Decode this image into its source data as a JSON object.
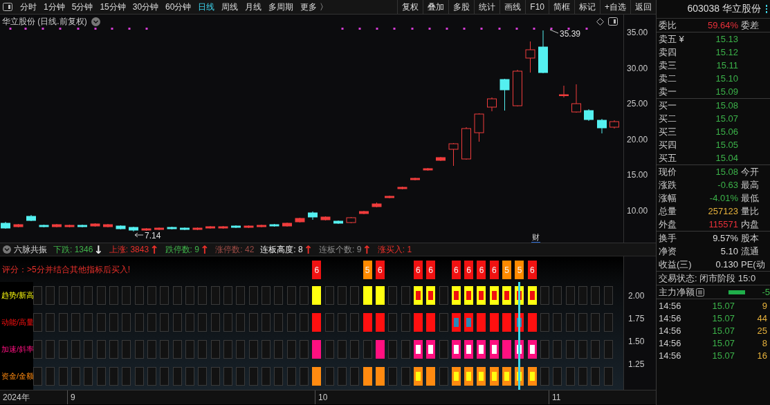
{
  "toolbar": {
    "periods": [
      {
        "label": "分时",
        "selected": false
      },
      {
        "label": "1分钟",
        "selected": false
      },
      {
        "label": "5分钟",
        "selected": false
      },
      {
        "label": "15分钟",
        "selected": false
      },
      {
        "label": "30分钟",
        "selected": false
      },
      {
        "label": "60分钟",
        "selected": false
      },
      {
        "label": "日线",
        "selected": true
      },
      {
        "label": "周线",
        "selected": false
      },
      {
        "label": "月线",
        "selected": false
      },
      {
        "label": "多周期",
        "selected": false
      },
      {
        "label": "更多 〉",
        "selected": false
      }
    ],
    "tools": [
      "复权",
      "叠加",
      "多股",
      "统计",
      "画线",
      "F10",
      "简框",
      "标记",
      "+自选",
      "返回"
    ]
  },
  "chart": {
    "title": "华立股份 (日线.前复权)",
    "price_axis": [
      "35.00",
      "30.00",
      "25.00",
      "20.00",
      "15.00",
      "10.00"
    ],
    "high_label": "35.39",
    "low_label": "7.14",
    "event_marker": "财"
  },
  "indicator": {
    "title": "六脉共振",
    "stats": [
      {
        "label": "下跌: 1346",
        "color": "#3fb24a",
        "arrow": {
          "text": "↓",
          "color": "#eeeeee"
        }
      },
      {
        "label": "上涨: 3843",
        "color": "#e8302a",
        "arrow": {
          "text": "↑",
          "color": "#e8302a"
        }
      },
      {
        "label": "跌停数: 9",
        "color": "#3fb24a",
        "arrow": {
          "text": "↑",
          "color": "#e8302a"
        }
      },
      {
        "label": "涨停数: 42",
        "color": "#9a4a44"
      },
      {
        "label": "连板高度: 8",
        "color": "#f0f0f0",
        "arrow": {
          "text": "↑",
          "color": "#e8302a"
        }
      },
      {
        "label": "连板个数: 9",
        "color": "#8c8c8c",
        "arrow": {
          "text": "↑",
          "color": "#e8302a"
        }
      },
      {
        "label": "涨买入: 1",
        "color": "#e8302a"
      }
    ],
    "hint": "评分：>5分并结合其他指标后买入!",
    "scores": [
      {
        "kind": "none",
        "cursor": false
      },
      {
        "kind": "none",
        "cursor": false
      },
      {
        "kind": "none",
        "cursor": false
      },
      {
        "kind": "none",
        "cursor": false
      },
      {
        "kind": "none",
        "cursor": false
      },
      {
        "kind": "none",
        "cursor": false
      },
      {
        "kind": "none",
        "cursor": false
      },
      {
        "kind": "none",
        "cursor": false
      },
      {
        "kind": "none",
        "cursor": false
      },
      {
        "kind": "none",
        "cursor": false
      },
      {
        "kind": "none",
        "cursor": false
      },
      {
        "kind": "none",
        "cursor": false
      },
      {
        "kind": "none",
        "cursor": false
      },
      {
        "kind": "none",
        "cursor": false
      },
      {
        "kind": "none",
        "cursor": false
      },
      {
        "kind": "none",
        "cursor": false
      },
      {
        "kind": "none",
        "cursor": false
      },
      {
        "kind": "none",
        "cursor": false
      },
      {
        "kind": "none",
        "cursor": false
      },
      {
        "kind": "none",
        "cursor": false
      },
      {
        "kind": "none",
        "cursor": false
      },
      {
        "kind": "none",
        "cursor": false
      },
      {
        "kind": "score",
        "text": "6",
        "color": "#f01212",
        "cursor": false
      },
      {
        "kind": "none",
        "cursor": false
      },
      {
        "kind": "none",
        "cursor": false
      },
      {
        "kind": "none",
        "cursor": false
      },
      {
        "kind": "score",
        "text": "5",
        "color": "#ff8a00",
        "cursor": false
      },
      {
        "kind": "score",
        "text": "6",
        "color": "#f01212",
        "cursor": false
      },
      {
        "kind": "none",
        "cursor": false
      },
      {
        "kind": "none",
        "cursor": false
      },
      {
        "kind": "score",
        "text": "6",
        "color": "#f01212",
        "cursor": false
      },
      {
        "kind": "score",
        "text": "6",
        "color": "#f01212",
        "cursor": false
      },
      {
        "kind": "none",
        "cursor": false
      },
      {
        "kind": "score",
        "text": "6",
        "color": "#f01212",
        "cursor": false
      },
      {
        "kind": "score",
        "text": "6",
        "color": "#f01212",
        "cursor": false
      },
      {
        "kind": "score",
        "text": "6",
        "color": "#f01212",
        "cursor": false
      },
      {
        "kind": "score",
        "text": "6",
        "color": "#f01212",
        "cursor": false
      },
      {
        "kind": "score",
        "text": "5",
        "color": "#ff8a00",
        "cursor": false
      },
      {
        "kind": "score",
        "text": "5",
        "color": "#ff8a00",
        "cursor": true
      },
      {
        "kind": "score",
        "text": "6",
        "color": "#f01212",
        "cursor": false
      },
      {
        "kind": "none",
        "cursor": false
      },
      {
        "kind": "none",
        "cursor": false
      },
      {
        "kind": "none",
        "cursor": false
      },
      {
        "kind": "none",
        "cursor": false
      },
      {
        "kind": "none",
        "cursor": false
      },
      {
        "kind": "none",
        "cursor": false
      }
    ],
    "rows": [
      {
        "kind": "trend",
        "label": "趋势/新高",
        "color": "#ffff10",
        "cells": [
          {
            "filled": false,
            "marked": false
          },
          {
            "filled": false,
            "marked": false
          },
          {
            "filled": false,
            "marked": false
          },
          {
            "filled": false,
            "marked": false
          },
          {
            "filled": false,
            "marked": false
          },
          {
            "filled": false,
            "marked": false
          },
          {
            "filled": false,
            "marked": false
          },
          {
            "filled": false,
            "marked": false
          },
          {
            "filled": false,
            "marked": false
          },
          {
            "filled": false,
            "marked": false
          },
          {
            "filled": false,
            "marked": false
          },
          {
            "filled": false,
            "marked": false
          },
          {
            "filled": false,
            "marked": false
          },
          {
            "filled": false,
            "marked": false
          },
          {
            "filled": false,
            "marked": false
          },
          {
            "filled": false,
            "marked": false
          },
          {
            "filled": false,
            "marked": false
          },
          {
            "filled": false,
            "marked": false
          },
          {
            "filled": false,
            "marked": false
          },
          {
            "filled": false,
            "marked": false
          },
          {
            "filled": false,
            "marked": false
          },
          {
            "filled": false,
            "marked": false
          },
          {
            "filled": true,
            "marked": false
          },
          {
            "filled": false,
            "marked": false
          },
          {
            "filled": false,
            "marked": false
          },
          {
            "filled": false,
            "marked": false
          },
          {
            "filled": true,
            "marked": false
          },
          {
            "filled": true,
            "marked": false
          },
          {
            "filled": false,
            "marked": false
          },
          {
            "filled": false,
            "marked": false
          },
          {
            "filled": true,
            "marked": true
          },
          {
            "filled": true,
            "marked": true
          },
          {
            "filled": false,
            "marked": false
          },
          {
            "filled": true,
            "marked": true
          },
          {
            "filled": true,
            "marked": true
          },
          {
            "filled": true,
            "marked": true
          },
          {
            "filled": true,
            "marked": true
          },
          {
            "filled": true,
            "marked": true
          },
          {
            "filled": true,
            "marked": true
          },
          {
            "filled": true,
            "marked": true
          },
          {
            "filled": false,
            "marked": false
          },
          {
            "filled": false,
            "marked": false
          },
          {
            "filled": false,
            "marked": false
          },
          {
            "filled": false,
            "marked": false
          },
          {
            "filled": false,
            "marked": false
          },
          {
            "filled": false,
            "marked": false
          }
        ]
      },
      {
        "kind": "momentum",
        "label": "动能/高量",
        "color": "#ff1010",
        "cells": [
          {
            "filled": false,
            "marked": false
          },
          {
            "filled": false,
            "marked": false
          },
          {
            "filled": false,
            "marked": false
          },
          {
            "filled": false,
            "marked": false
          },
          {
            "filled": false,
            "marked": false
          },
          {
            "filled": false,
            "marked": false
          },
          {
            "filled": false,
            "marked": false
          },
          {
            "filled": false,
            "marked": false
          },
          {
            "filled": false,
            "marked": false
          },
          {
            "filled": false,
            "marked": false
          },
          {
            "filled": false,
            "marked": false
          },
          {
            "filled": false,
            "marked": false
          },
          {
            "filled": false,
            "marked": false
          },
          {
            "filled": false,
            "marked": false
          },
          {
            "filled": false,
            "marked": false
          },
          {
            "filled": false,
            "marked": false
          },
          {
            "filled": false,
            "marked": false
          },
          {
            "filled": false,
            "marked": false
          },
          {
            "filled": false,
            "marked": false
          },
          {
            "filled": false,
            "marked": false
          },
          {
            "filled": false,
            "marked": false
          },
          {
            "filled": false,
            "marked": false
          },
          {
            "filled": true,
            "marked": false
          },
          {
            "filled": false,
            "marked": false
          },
          {
            "filled": false,
            "marked": false
          },
          {
            "filled": false,
            "marked": false
          },
          {
            "filled": true,
            "marked": false
          },
          {
            "filled": true,
            "marked": false
          },
          {
            "filled": false,
            "marked": false
          },
          {
            "filled": false,
            "marked": false
          },
          {
            "filled": true,
            "marked": false
          },
          {
            "filled": true,
            "marked": false
          },
          {
            "filled": false,
            "marked": false
          },
          {
            "filled": true,
            "marked": true
          },
          {
            "filled": true,
            "marked": true
          },
          {
            "filled": true,
            "marked": false
          },
          {
            "filled": true,
            "marked": false
          },
          {
            "filled": true,
            "marked": false
          },
          {
            "filled": true,
            "marked": true
          },
          {
            "filled": true,
            "marked": false
          },
          {
            "filled": false,
            "marked": false
          },
          {
            "filled": false,
            "marked": false
          },
          {
            "filled": false,
            "marked": false
          },
          {
            "filled": false,
            "marked": false
          },
          {
            "filled": false,
            "marked": false
          },
          {
            "filled": false,
            "marked": false
          }
        ]
      },
      {
        "kind": "acceleration",
        "label": "加速/斜率",
        "color": "#ff1080",
        "cells": [
          {
            "filled": false,
            "marked": false
          },
          {
            "filled": false,
            "marked": false
          },
          {
            "filled": false,
            "marked": false
          },
          {
            "filled": false,
            "marked": false
          },
          {
            "filled": false,
            "marked": false
          },
          {
            "filled": false,
            "marked": false
          },
          {
            "filled": false,
            "marked": false
          },
          {
            "filled": false,
            "marked": false
          },
          {
            "filled": false,
            "marked": false
          },
          {
            "filled": false,
            "marked": false
          },
          {
            "filled": false,
            "marked": false
          },
          {
            "filled": false,
            "marked": false
          },
          {
            "filled": false,
            "marked": false
          },
          {
            "filled": false,
            "marked": false
          },
          {
            "filled": false,
            "marked": false
          },
          {
            "filled": false,
            "marked": false
          },
          {
            "filled": false,
            "marked": false
          },
          {
            "filled": false,
            "marked": false
          },
          {
            "filled": false,
            "marked": false
          },
          {
            "filled": false,
            "marked": false
          },
          {
            "filled": false,
            "marked": false
          },
          {
            "filled": false,
            "marked": false
          },
          {
            "filled": true,
            "marked": false
          },
          {
            "filled": false,
            "marked": false
          },
          {
            "filled": false,
            "marked": false
          },
          {
            "filled": false,
            "marked": false
          },
          {
            "filled": false,
            "marked": false
          },
          {
            "filled": true,
            "marked": false
          },
          {
            "filled": false,
            "marked": false
          },
          {
            "filled": false,
            "marked": false
          },
          {
            "filled": true,
            "marked": true
          },
          {
            "filled": true,
            "marked": true
          },
          {
            "filled": false,
            "marked": false
          },
          {
            "filled": true,
            "marked": true
          },
          {
            "filled": true,
            "marked": true
          },
          {
            "filled": true,
            "marked": true
          },
          {
            "filled": true,
            "marked": true
          },
          {
            "filled": true,
            "marked": false
          },
          {
            "filled": true,
            "marked": true
          },
          {
            "filled": true,
            "marked": true
          },
          {
            "filled": false,
            "marked": false
          },
          {
            "filled": false,
            "marked": false
          },
          {
            "filled": false,
            "marked": false
          },
          {
            "filled": false,
            "marked": false
          },
          {
            "filled": false,
            "marked": false
          },
          {
            "filled": false,
            "marked": false
          }
        ]
      },
      {
        "kind": "funds",
        "label": "资金/金额",
        "color": "#ff8a10",
        "cells": [
          {
            "filled": false,
            "marked": false
          },
          {
            "filled": false,
            "marked": false
          },
          {
            "filled": false,
            "marked": false
          },
          {
            "filled": false,
            "marked": false
          },
          {
            "filled": false,
            "marked": false
          },
          {
            "filled": false,
            "marked": false
          },
          {
            "filled": false,
            "marked": false
          },
          {
            "filled": false,
            "marked": false
          },
          {
            "filled": false,
            "marked": false
          },
          {
            "filled": false,
            "marked": false
          },
          {
            "filled": false,
            "marked": false
          },
          {
            "filled": false,
            "marked": false
          },
          {
            "filled": false,
            "marked": false
          },
          {
            "filled": false,
            "marked": false
          },
          {
            "filled": false,
            "marked": false
          },
          {
            "filled": false,
            "marked": false
          },
          {
            "filled": false,
            "marked": false
          },
          {
            "filled": false,
            "marked": false
          },
          {
            "filled": false,
            "marked": false
          },
          {
            "filled": false,
            "marked": false
          },
          {
            "filled": false,
            "marked": false
          },
          {
            "filled": false,
            "marked": false
          },
          {
            "filled": true,
            "marked": false
          },
          {
            "filled": false,
            "marked": false
          },
          {
            "filled": false,
            "marked": false
          },
          {
            "filled": false,
            "marked": false
          },
          {
            "filled": true,
            "marked": false
          },
          {
            "filled": true,
            "marked": false
          },
          {
            "filled": false,
            "marked": false
          },
          {
            "filled": false,
            "marked": false
          },
          {
            "filled": true,
            "marked": true
          },
          {
            "filled": true,
            "marked": false
          },
          {
            "filled": false,
            "marked": false
          },
          {
            "filled": true,
            "marked": true
          },
          {
            "filled": true,
            "marked": true
          },
          {
            "filled": true,
            "marked": true
          },
          {
            "filled": true,
            "marked": true
          },
          {
            "filled": true,
            "marked": true
          },
          {
            "filled": true,
            "marked": true
          },
          {
            "filled": true,
            "marked": true
          },
          {
            "filled": false,
            "marked": false
          },
          {
            "filled": false,
            "marked": false
          },
          {
            "filled": false,
            "marked": false
          },
          {
            "filled": false,
            "marked": false
          },
          {
            "filled": false,
            "marked": false
          },
          {
            "filled": false,
            "marked": false
          }
        ]
      }
    ],
    "axis": [
      "2.00",
      "1.75",
      "1.50",
      "1.25"
    ]
  },
  "date_axis": [
    "2024年",
    "9",
    "10",
    "11"
  ],
  "quote": {
    "code_name": "603038 华立股份",
    "ratio": {
      "label": "委比",
      "value": "59.64%",
      "label2": "委差",
      "color": "#e8303a"
    },
    "asks": [
      {
        "label": "卖五 ¥",
        "price": "15.13"
      },
      {
        "label": "卖四",
        "price": "15.12"
      },
      {
        "label": "卖三",
        "price": "15.11"
      },
      {
        "label": "卖二",
        "price": "15.10"
      },
      {
        "label": "卖一",
        "price": "15.09"
      }
    ],
    "bids": [
      {
        "label": "买一",
        "price": "15.08"
      },
      {
        "label": "买二",
        "price": "15.07"
      },
      {
        "label": "买三",
        "price": "15.06"
      },
      {
        "label": "买四",
        "price": "15.05"
      },
      {
        "label": "买五",
        "price": "15.04"
      }
    ],
    "stats": [
      {
        "label": "现价",
        "value": "15.08",
        "label2": "今开",
        "color": "#3cb34a"
      },
      {
        "label": "涨跌",
        "value": "-0.63",
        "label2": "最高",
        "color": "#3cb34a"
      },
      {
        "label": "涨幅",
        "value": "-4.01%",
        "label2": "最低",
        "color": "#3cb34a"
      },
      {
        "label": "总量",
        "value": "257123",
        "label2": "量比",
        "color": "#e8b33c"
      },
      {
        "label": "外盘",
        "value": "115571",
        "label2": "内盘",
        "color": "#e8303a"
      }
    ],
    "fundamentals": [
      {
        "label": "换手",
        "value": "9.57%",
        "label2": "股本",
        "color": "#dddddd"
      },
      {
        "label": "净资",
        "value": "5.10",
        "label2": "流通",
        "color": "#dddddd"
      },
      {
        "label": "收益(三)",
        "value": "0.130",
        "label2": "PE(动",
        "color": "#dddddd"
      }
    ],
    "trading_status": "交易状态: 闭市阶段 15:0",
    "main_force": {
      "label": "主力净额",
      "value": "-5"
    },
    "ticks": [
      {
        "time": "14:56",
        "price": "15.07",
        "volume": "9"
      },
      {
        "time": "14:56",
        "price": "15.07",
        "volume": "44"
      },
      {
        "time": "14:56",
        "price": "15.07",
        "volume": "25"
      },
      {
        "time": "14:56",
        "price": "15.07",
        "volume": "8"
      },
      {
        "time": "14:56",
        "price": "15.07",
        "volume": "16"
      }
    ]
  }
}
